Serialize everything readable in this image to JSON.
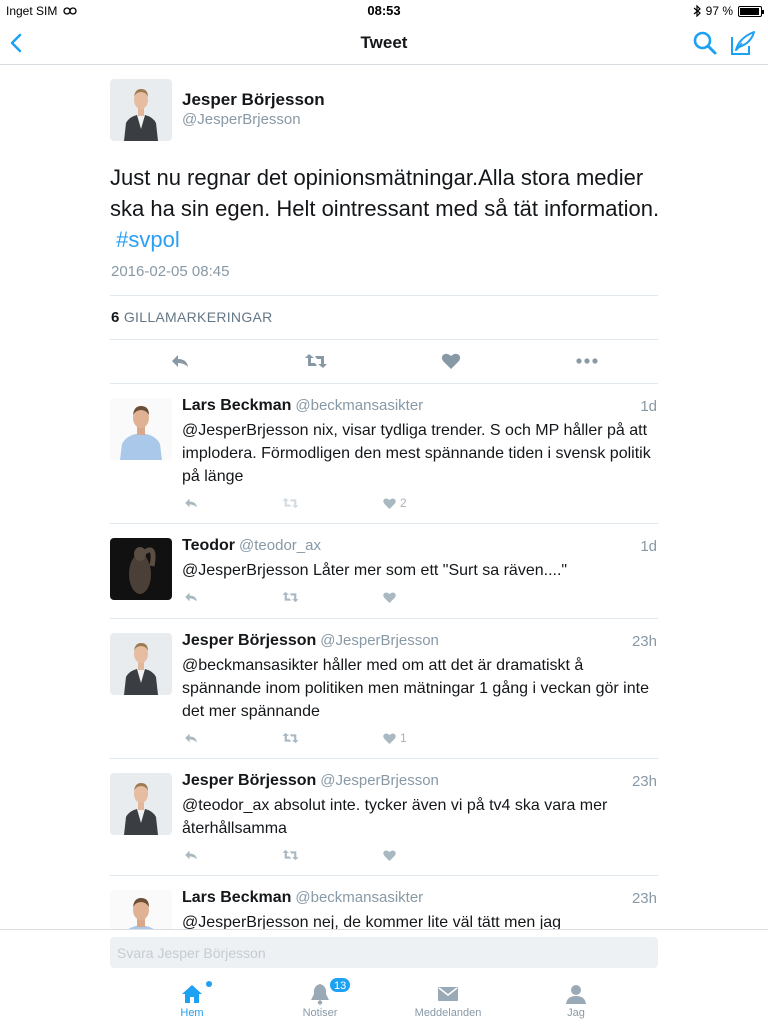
{
  "status_bar": {
    "carrier": "Inget SIM",
    "time": "08:53",
    "battery": "97 %",
    "battery_level": 0.97
  },
  "nav": {
    "title": "Tweet",
    "back_icon": "chevron-left-icon",
    "search_icon": "search-icon",
    "compose_icon": "compose-icon"
  },
  "tweet": {
    "name": "Jesper Börjesson",
    "handle": "@JesperBrjesson",
    "text": "Just nu regnar det opinionsmätningar.Alla stora medier ska ha sin egen. Helt ointressant med så tät information.",
    "hashtag": "#svpol",
    "date": "2016-02-05 08:45",
    "likes_count": "6",
    "likes_label": "GILLAMARKERINGAR"
  },
  "replies": [
    {
      "name": "Lars Beckman",
      "handle": "@beckmansasikter",
      "ago": "1d",
      "text": "@JesperBrjesson nix, visar tydliga trender. S och MP håller på att implodera. Förmodligen den mest spännande tiden i svensk politik på länge",
      "like_count": "2"
    },
    {
      "name": "Teodor",
      "handle": "@teodor_ax",
      "ago": "1d",
      "text": "@JesperBrjesson Låter mer som ett \"Surt sa räven....\"",
      "like_count": ""
    },
    {
      "name": "Jesper Börjesson",
      "handle": "@JesperBrjesson",
      "ago": "23h",
      "text": "@beckmansasikter håller med om att det är dramatiskt å spännande inom politiken men mätningar 1 gång i veckan gör inte det mer spännande",
      "like_count": "1"
    },
    {
      "name": "Jesper Börjesson",
      "handle": "@JesperBrjesson",
      "ago": "23h",
      "text": "@teodor_ax absolut inte. tycker även vi på tv4 ska vara mer återhållsamma",
      "like_count": ""
    },
    {
      "name": "Lars Beckman",
      "handle": "@beckmansasikter",
      "ago": "23h",
      "text": "@JesperBrjesson nej, de kommer lite väl tätt men jag",
      "like_count": ""
    }
  ],
  "reply_box": {
    "placeholder": "Svara Jesper Börjesson"
  },
  "tabs": [
    {
      "label": "Hem",
      "icon": "home-icon"
    },
    {
      "label": "Notiser",
      "icon": "bell-icon",
      "badge": "13"
    },
    {
      "label": "Meddelanden",
      "icon": "envelope-icon"
    },
    {
      "label": "Jag",
      "icon": "person-icon"
    }
  ],
  "colors": {
    "accent": "#1da1f2",
    "muted": "#8899a6",
    "divider": "#e1e8ed"
  }
}
